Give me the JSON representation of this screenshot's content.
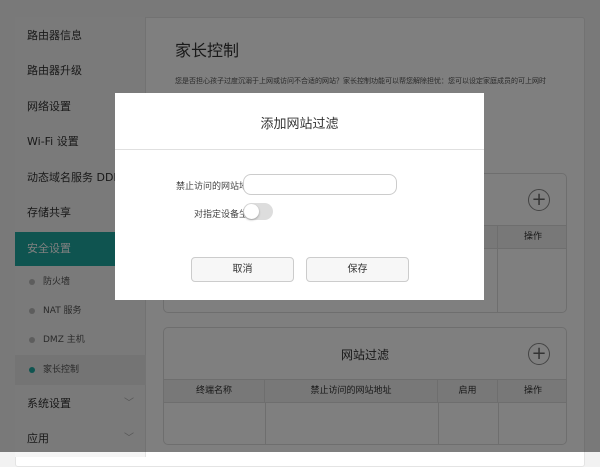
{
  "sidebar": {
    "items": [
      "路由器信息",
      "路由器升级",
      "网络设置",
      "Wi-Fi 设置",
      "动态域名服务 DDNS",
      "存储共享",
      "安全设置"
    ],
    "sub_items": [
      "防火墙",
      "NAT 服务",
      "DMZ 主机",
      "家长控制"
    ],
    "bottom_items": [
      "系统设置",
      "应用"
    ]
  },
  "main": {
    "title": "家长控制",
    "description": "您是否担心孩子过度沉溺于上网或访问不合适的网站？家长控制功能可以帮您解除担忧：您可以设定家庭成员的可上网时",
    "table1": {
      "headers": [
        "操作"
      ]
    },
    "table2": {
      "title": "网站过滤",
      "headers": [
        "终端名称",
        "禁止访问的网站地址",
        "启用",
        "操作"
      ]
    }
  },
  "modal": {
    "title": "添加网站过滤",
    "url_label": "禁止访问的网站地址",
    "url_value": "",
    "device_label": "对指定设备生效",
    "device_toggle": false,
    "cancel": "取消",
    "save": "保存"
  },
  "colors": {
    "accent": "#1fa9a0"
  }
}
